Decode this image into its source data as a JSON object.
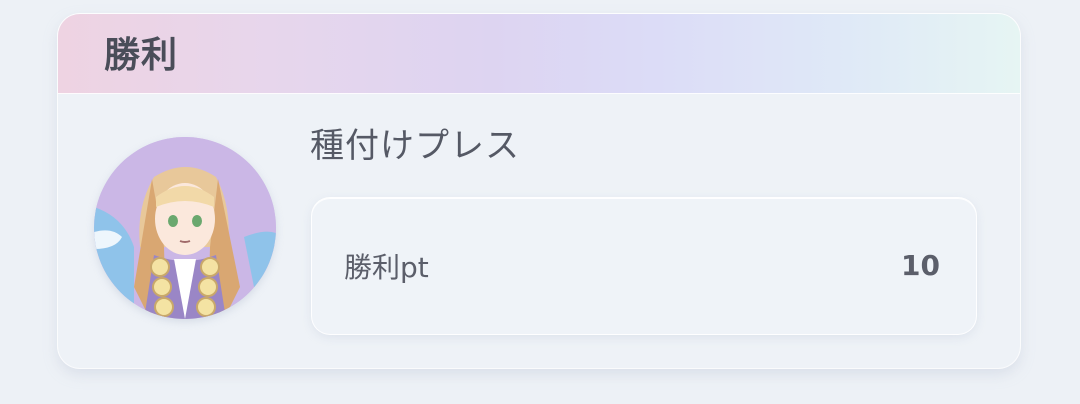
{
  "card": {
    "title": "勝利",
    "move_name": "種付けプレス",
    "avatar_icon": "character-portrait-icon",
    "stat": {
      "label": "勝利pt",
      "value": "10"
    }
  }
}
